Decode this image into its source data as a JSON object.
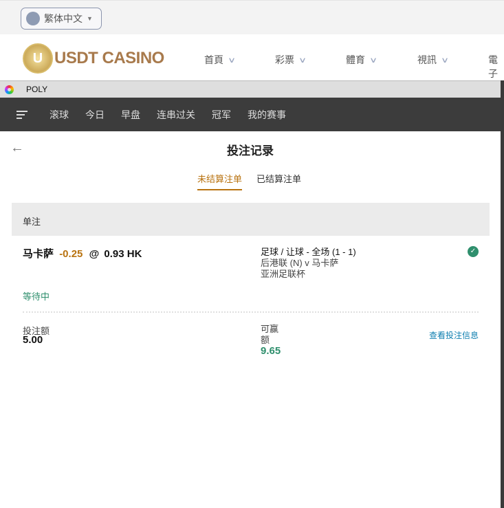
{
  "site": {
    "language": "繁体中文",
    "logo_text": "USDT CASINO",
    "nav": [
      "首頁",
      "彩票",
      "體育",
      "視訊",
      "電子"
    ]
  },
  "popup": {
    "title": "POLY",
    "nav": [
      "滚球",
      "今日",
      "早盘",
      "连串过关",
      "冠军",
      "我的赛事"
    ],
    "page_title": "投注记录",
    "tabs": [
      "未结算注单",
      "已结算注单"
    ],
    "section": "单注",
    "bet": {
      "selection": "马卡萨",
      "handicap": "-0.25",
      "at": "@",
      "odds": "0.93 HK",
      "market": "足球 / 让球 - 全场 (1 - 1)",
      "match": "后港联 (N) v 马卡萨",
      "league": "亚洲足联杯",
      "status": "等待中",
      "stake_label": "投注额",
      "stake": "5.00",
      "win_label_1": "可赢",
      "win_label_2": "额",
      "win": "9.65",
      "details_link": "查看投注信息"
    }
  },
  "colors": {
    "accent": "#b8720f",
    "green": "#2f8f6d",
    "link": "#0f7fb0"
  }
}
